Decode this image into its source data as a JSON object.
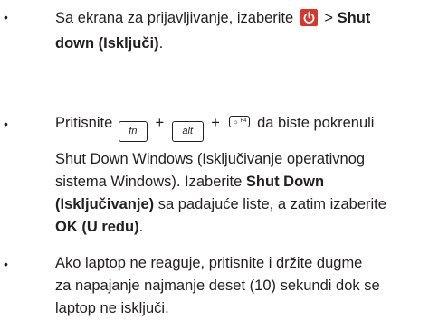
{
  "items": [
    {
      "bullet": "•",
      "line1_prefix": "Sa ekrana za prijavljivanje, izaberite",
      "line1_gt": ">",
      "line1_bold": "Shut",
      "line2_bold": "down (Isključi)",
      "line2_suffix": "."
    },
    {
      "bullet": "•",
      "line1_prefix": "Pritisnite",
      "key_fn": "fn",
      "key_alt": "alt",
      "key_f4": "F4",
      "plus": "+",
      "line1_suffix": "da biste pokrenuli",
      "line2": "Shut Down Windows (Isključivanje operativnog",
      "line3_prefix": "sistema Windows). Izaberite",
      "line3_bold": "Shut Down",
      "line4_bold": "(Isključivanje)",
      "line4_suffix": "sa padajuće liste, a zatim izaberite",
      "line5_bold": "OK (U redu)",
      "line5_suffix": "."
    },
    {
      "bullet": "•",
      "line1": "Ako laptop ne reaguje, pritisnite i držite dugme",
      "line2": "za napajanje najmanje deset (10) sekundi dok se",
      "line3": "laptop ne isključi."
    }
  ],
  "colors": {
    "text": "#231f20",
    "power_icon_bg": "#d9362b"
  },
  "icons": {
    "power": "power-icon"
  }
}
